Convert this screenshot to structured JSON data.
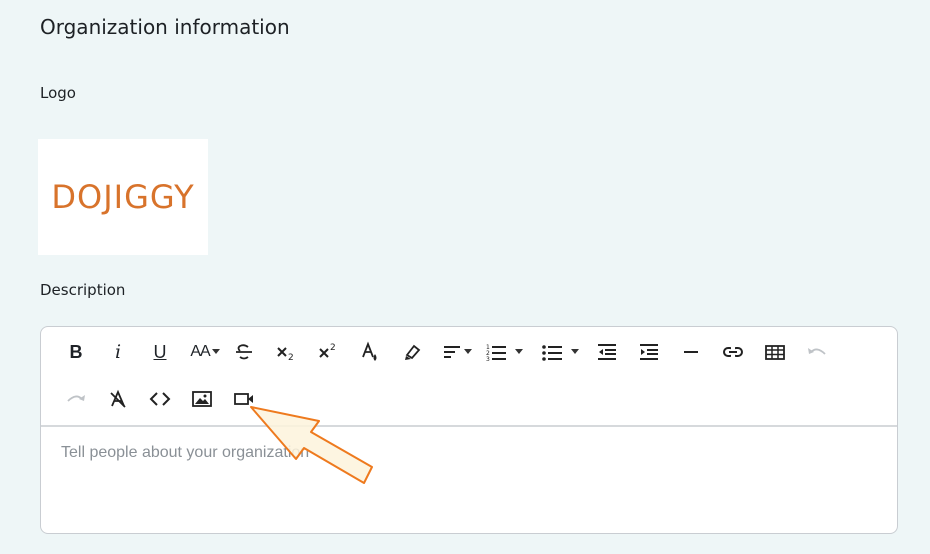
{
  "section": {
    "title": "Organization information"
  },
  "logo": {
    "label": "Logo",
    "image_text": "DOJIGGY",
    "brand_color": "#d8732b"
  },
  "description": {
    "label": "Description",
    "placeholder": "Tell people about your organization"
  },
  "toolbar": {
    "row1": [
      "bold",
      "italic",
      "underline",
      "font-size",
      "strikethrough",
      "subscript",
      "superscript",
      "font-color",
      "highlight",
      "align",
      "ordered-list",
      "unordered-list",
      "outdent",
      "indent",
      "horizontal-rule",
      "link",
      "table",
      "undo"
    ],
    "row2": [
      "redo",
      "clear-format",
      "code-view",
      "insert-image",
      "insert-video"
    ],
    "bold_glyph": "B",
    "italic_glyph": "i",
    "underline_glyph": "U",
    "font_size_glyph": "AA",
    "code_glyph": "<>"
  },
  "colors": {
    "accent_arrow": "#ee7a1e",
    "arrow_fill": "#fdf3dc",
    "background": "#eef6f7"
  }
}
